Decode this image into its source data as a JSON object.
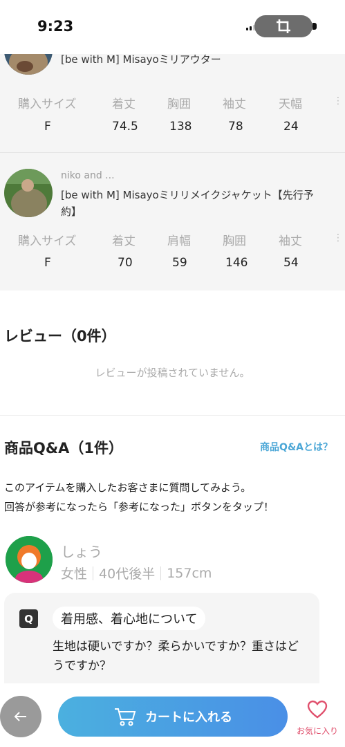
{
  "status": {
    "time": "9:23"
  },
  "purchases": [
    {
      "brand": "",
      "name": "[be with M] Misayoミリアウター",
      "headers": [
        "購入サイズ",
        "着丈",
        "胸囲",
        "袖丈",
        "天幅"
      ],
      "values": [
        "F",
        "74.5",
        "138",
        "78",
        "24"
      ]
    },
    {
      "brand": "niko and ...",
      "name_line1": "[be with M] Misayoミリリメイクジャケット【先行予",
      "name_line2": "約】",
      "headers": [
        "購入サイズ",
        "着丈",
        "肩幅",
        "胸囲",
        "袖丈"
      ],
      "values": [
        "F",
        "70",
        "59",
        "146",
        "54"
      ]
    }
  ],
  "reviews": {
    "title": "レビュー（0件）",
    "empty": "レビューが投稿されていません。"
  },
  "qa": {
    "title": "商品Q&A（1件）",
    "link": "商品Q&Aとは？",
    "intro_line1": "このアイテムを購入したお客さまに質問してみよう。",
    "intro_line2": "回答が参考になったら「参考になった」ボタンをタップ！",
    "user": {
      "name": "しょう",
      "gender": "女性",
      "age": "40代後半",
      "height": "157cm"
    },
    "question": {
      "badge": "Q",
      "topic": "着用感、着心地について",
      "body": "生地は硬いですか？柔らかいですか？重さはどうですか？"
    }
  },
  "bottom": {
    "cart_label": "カートに入れる",
    "fav_label": "お気に入り"
  },
  "colors": {
    "accent": "#4aa6d6",
    "cart_start": "#4bb0df",
    "cart_end": "#4a8fe6",
    "fav": "#e0506d",
    "avatar_bg": "#1ea04a"
  }
}
